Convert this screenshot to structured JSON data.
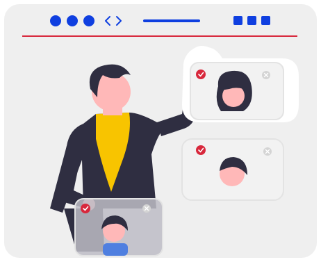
{
  "colors": {
    "frame_bg": "#efefef",
    "accent_blue": "#0f3fe0",
    "accent_red": "#d8283c",
    "figure_dark": "#2f2e41",
    "skin": "#ffb8b8",
    "scarf": "#f8c400",
    "shirt_blue": "#4f7fe0",
    "card_bg": "#f2f2f2",
    "card_border": "#e3e3e3"
  },
  "window_chrome": {
    "dots": [
      "dot",
      "dot",
      "dot"
    ],
    "code_icon": "code-brackets-icon",
    "squares": [
      "square",
      "square",
      "square"
    ]
  },
  "cards": [
    {
      "name": "selected-profile-card-top",
      "check_icon": "check-circle-icon",
      "close_icon": "close-circle-icon",
      "avatar": "avatar-long-hair"
    },
    {
      "name": "selected-profile-card-middle",
      "check_icon": "check-circle-icon",
      "close_icon": "close-circle-icon",
      "avatar": "avatar-short-hair"
    },
    {
      "name": "selected-profile-card-bottom",
      "check_icon": "check-circle-icon",
      "close_icon": "close-circle-icon",
      "avatar": "avatar-short-hair-blue-shirt"
    }
  ]
}
